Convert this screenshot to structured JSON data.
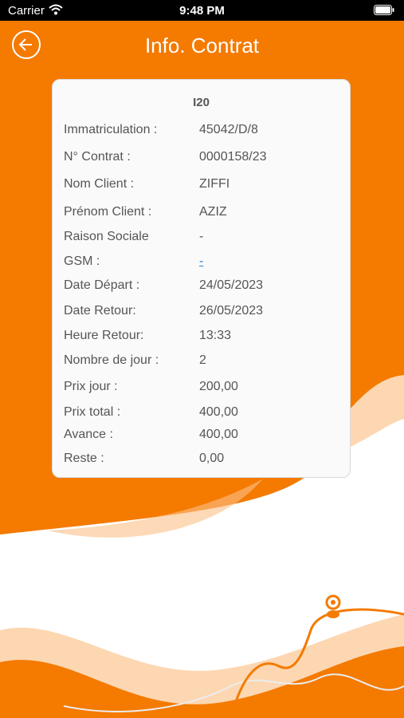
{
  "status_bar": {
    "carrier": "Carrier",
    "time": "9:48 PM"
  },
  "header": {
    "title": "Info. Contrat"
  },
  "card": {
    "title": "I20",
    "rows": [
      {
        "label": "Immatriculation :",
        "value": "45042/D/8"
      },
      {
        "label": "N° Contrat :",
        "value": "0000158/23"
      },
      {
        "label": "Nom Client :",
        "value": "ZIFFI"
      },
      {
        "label": "Prénom Client :",
        "value": "AZIZ"
      },
      {
        "label": "Raison Sociale",
        "value": "-"
      },
      {
        "label": "GSM :",
        "value": "-"
      },
      {
        "label": "Date Départ :",
        "value": "24/05/2023"
      },
      {
        "label": "Date Retour:",
        "value": "26/05/2023"
      },
      {
        "label": "Heure Retour:",
        "value": "13:33"
      },
      {
        "label": "Nombre de jour :",
        "value": "2"
      },
      {
        "label": "Prix jour :",
        "value": "200,00"
      },
      {
        "label": "Prix total :",
        "value": "400,00"
      },
      {
        "label": "Avance :",
        "value": "400,00"
      },
      {
        "label": "Reste :",
        "value": "0,00"
      }
    ]
  },
  "colors": {
    "primary": "#f47a00",
    "light": "#fdd7b2",
    "card_bg": "#fafafa",
    "link": "#2a7fd4"
  },
  "icons": {
    "back": "back-arrow-icon",
    "wifi": "wifi-icon",
    "battery": "battery-icon",
    "location": "location-pin-icon"
  }
}
